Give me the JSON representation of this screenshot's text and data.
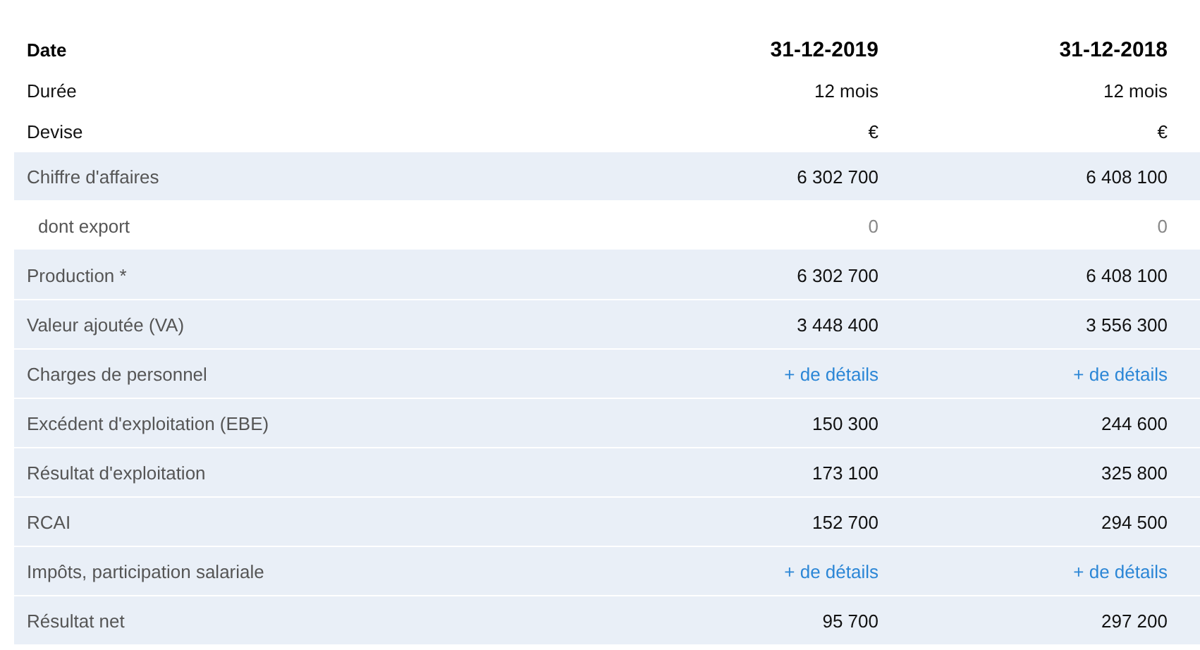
{
  "header": [
    {
      "label": "Date",
      "values": [
        "31-12-2019",
        "31-12-2018"
      ],
      "kind": "title"
    },
    {
      "label": "Durée",
      "values": [
        "12 mois",
        "12 mois"
      ],
      "kind": "plain"
    },
    {
      "label": "Devise",
      "values": [
        "€",
        "€"
      ],
      "kind": "plain"
    }
  ],
  "rows": [
    {
      "label": "Chiffre d'affaires",
      "kind": "main",
      "cells": [
        {
          "text": "6 302 700",
          "kind": "value"
        },
        {
          "text": "6 408 100",
          "kind": "value"
        }
      ]
    },
    {
      "label": "dont export",
      "kind": "sub",
      "cells": [
        {
          "text": "0",
          "kind": "value"
        },
        {
          "text": "0",
          "kind": "value"
        }
      ]
    },
    {
      "label": "Production *",
      "kind": "main",
      "cells": [
        {
          "text": "6 302 700",
          "kind": "value"
        },
        {
          "text": "6 408 100",
          "kind": "value"
        }
      ]
    },
    {
      "label": "Valeur ajoutée (VA)",
      "kind": "main",
      "cells": [
        {
          "text": "3 448 400",
          "kind": "value"
        },
        {
          "text": "3 556 300",
          "kind": "value"
        }
      ]
    },
    {
      "label": "Charges de personnel",
      "kind": "main",
      "cells": [
        {
          "text": "+ de détails",
          "kind": "link"
        },
        {
          "text": "+ de détails",
          "kind": "link"
        }
      ]
    },
    {
      "label": "Excédent d'exploitation (EBE)",
      "kind": "main",
      "cells": [
        {
          "text": "150 300",
          "kind": "value"
        },
        {
          "text": "244 600",
          "kind": "value"
        }
      ]
    },
    {
      "label": "Résultat d'exploitation",
      "kind": "main",
      "cells": [
        {
          "text": "173 100",
          "kind": "value"
        },
        {
          "text": "325 800",
          "kind": "value"
        }
      ]
    },
    {
      "label": "RCAI",
      "kind": "main",
      "cells": [
        {
          "text": "152 700",
          "kind": "value"
        },
        {
          "text": "294 500",
          "kind": "value"
        }
      ]
    },
    {
      "label": "Impôts, participation salariale",
      "kind": "main",
      "cells": [
        {
          "text": "+ de détails",
          "kind": "link"
        },
        {
          "text": "+ de détails",
          "kind": "link"
        }
      ]
    },
    {
      "label": "Résultat net",
      "kind": "main",
      "cells": [
        {
          "text": "95 700",
          "kind": "value"
        },
        {
          "text": "297 200",
          "kind": "value"
        }
      ]
    }
  ]
}
